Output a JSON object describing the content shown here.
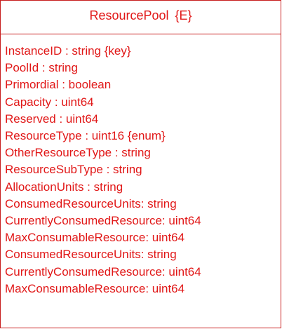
{
  "class_box": {
    "name": "ResourcePool",
    "stereotype": "{E}",
    "attributes": [
      "InstanceID : string {key}",
      "PoolId : string",
      "Primordial : boolean",
      "Capacity : uint64",
      "Reserved : uint64",
      "ResourceType : uint16 {enum}",
      "OtherResourceType : string",
      "ResourceSubType : string",
      "AllocationUnits : string",
      "ConsumedResourceUnits: string",
      "CurrentlyConsumedResource: uint64",
      "MaxConsumableResource: uint64",
      "ConsumedResourceUnits: string",
      "CurrentlyConsumedResource: uint64",
      "MaxConsumableResource: uint64"
    ]
  },
  "colors": {
    "text": "#e11717",
    "border": "#c81e1e",
    "background": "#ffffff"
  }
}
